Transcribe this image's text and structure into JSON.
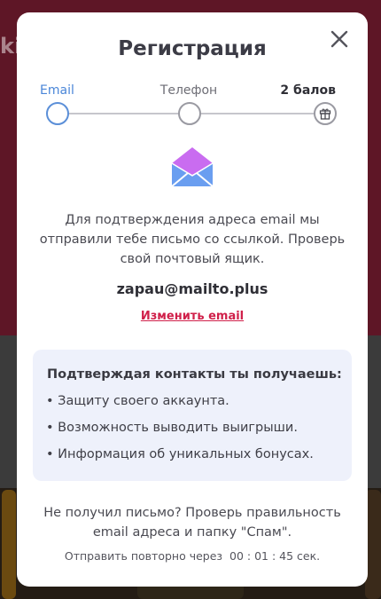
{
  "modal": {
    "title": "Регистрация",
    "steps": [
      {
        "label": "Email",
        "state": "active"
      },
      {
        "label": "Телефон",
        "state": "pending"
      },
      {
        "label": "2 балов",
        "state": "reward"
      }
    ],
    "icons": {
      "close": "close-icon",
      "envelope": "envelope-icon",
      "gift": "gift-icon"
    },
    "description": "Для подтверждения адреса email мы отправили тебе письмо со ссылкой. Проверь свой почтовый ящик.",
    "email": "zapau@mailto.plus",
    "change_email": "Изменить email",
    "benefits": {
      "title": "Подтверждая контакты ты получаешь:",
      "items": [
        "• Защиту своего аккаунта.",
        "• Возможность выводить выигрыши.",
        "• Информация об уникальных бонусах."
      ]
    },
    "resend_note": "Не получил письмо? Проверь правильность email адреса и папку \"Спам\".",
    "resend_timer": {
      "label": "Отправить повторно через",
      "value": "00 : 01 : 45",
      "unit": "сек."
    }
  },
  "colors": {
    "accent_blue": "#4a86d8",
    "link_red": "#d0204a",
    "envelope_top": "#c96cf0",
    "envelope_body": "#6a9ef0",
    "benefits_bg": "#eef1fb",
    "overlay_top": "#5e1626"
  }
}
